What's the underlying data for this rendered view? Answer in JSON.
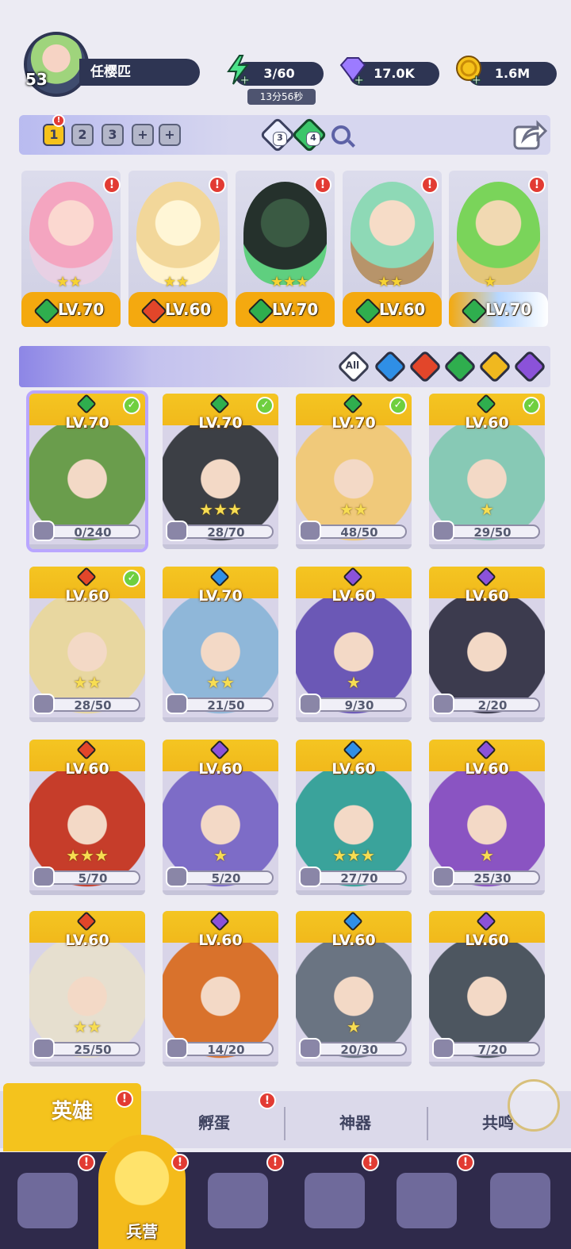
{
  "player": {
    "level": "53",
    "name": "任樱匹"
  },
  "resources": {
    "energy": {
      "value": "3/60",
      "timer": "13分56秒",
      "icon": "lightning-icon"
    },
    "gems": {
      "value": "17.0K",
      "icon": "diamond-icon"
    },
    "coins": {
      "value": "1.6M",
      "icon": "coin-icon"
    }
  },
  "team_tabs": [
    "1",
    "2",
    "3",
    "+",
    "+"
  ],
  "team_counts": {
    "a": "3",
    "b": "4"
  },
  "team": [
    {
      "level": "LV.70",
      "element": "nature",
      "stars": "★★"
    },
    {
      "level": "LV.60",
      "element": "fire",
      "stars": "★★"
    },
    {
      "level": "LV.70",
      "element": "nature",
      "stars": "★★★"
    },
    {
      "level": "LV.60",
      "element": "nature",
      "stars": "★★"
    },
    {
      "level": "LV.70",
      "element": "nature",
      "stars": "★"
    }
  ],
  "filters": {
    "all_label": "All",
    "elements": [
      "water",
      "fire",
      "nature",
      "light",
      "dark"
    ]
  },
  "colors": {
    "water": "#2f8fe6",
    "fire": "#e2462a",
    "nature": "#2fae4e",
    "light": "#f0b81f",
    "dark": "#8b52d9",
    "gold": "#f4c31d",
    "panel": "#2e3553"
  },
  "heroes": [
    {
      "level": "LV.70",
      "shards": "0/240",
      "element": "nature",
      "checked": true,
      "stars": "",
      "art": "#6a9d4c"
    },
    {
      "level": "LV.70",
      "shards": "28/70",
      "element": "nature",
      "checked": true,
      "stars": "★★★",
      "art": "#3c3f45"
    },
    {
      "level": "LV.70",
      "shards": "48/50",
      "element": "nature",
      "checked": true,
      "stars": "★★",
      "art": "#f0c97a"
    },
    {
      "level": "LV.60",
      "shards": "29/50",
      "element": "nature",
      "checked": true,
      "stars": "★",
      "art": "#87c9b5"
    },
    {
      "level": "LV.60",
      "shards": "28/50",
      "element": "fire",
      "checked": true,
      "stars": "★★",
      "art": "#e8d7a0"
    },
    {
      "level": "LV.70",
      "shards": "21/50",
      "element": "water",
      "checked": false,
      "stars": "★★",
      "art": "#8fb7d9"
    },
    {
      "level": "LV.60",
      "shards": "9/30",
      "element": "dark",
      "checked": false,
      "stars": "★",
      "art": "#6b58b6"
    },
    {
      "level": "LV.60",
      "shards": "2/20",
      "element": "dark",
      "checked": false,
      "stars": "",
      "art": "#3c3b4e"
    },
    {
      "level": "LV.60",
      "shards": "5/70",
      "element": "fire",
      "checked": false,
      "stars": "★★★",
      "art": "#c63d2a"
    },
    {
      "level": "LV.60",
      "shards": "5/20",
      "element": "dark",
      "checked": false,
      "stars": "★",
      "art": "#7d6cc7"
    },
    {
      "level": "LV.60",
      "shards": "27/70",
      "element": "water",
      "checked": false,
      "stars": "★★★",
      "art": "#3aa39b"
    },
    {
      "level": "LV.60",
      "shards": "25/30",
      "element": "dark",
      "checked": false,
      "stars": "★",
      "art": "#8a54c2"
    },
    {
      "level": "LV.60",
      "shards": "25/50",
      "element": "fire",
      "checked": false,
      "stars": "★★",
      "art": "#e6dfcf"
    },
    {
      "level": "LV.60",
      "shards": "14/20",
      "element": "dark",
      "checked": false,
      "stars": "",
      "art": "#d9722c"
    },
    {
      "level": "LV.60",
      "shards": "20/30",
      "element": "water",
      "checked": false,
      "stars": "★",
      "art": "#6a7482"
    },
    {
      "level": "LV.60",
      "shards": "7/20",
      "element": "dark",
      "checked": false,
      "stars": "",
      "art": "#4d5660"
    }
  ],
  "sub_tabs": [
    "英雄",
    "孵蛋",
    "神器",
    "共鸣"
  ],
  "bottom_nav": {
    "active_label": "兵营",
    "alert": "!"
  }
}
